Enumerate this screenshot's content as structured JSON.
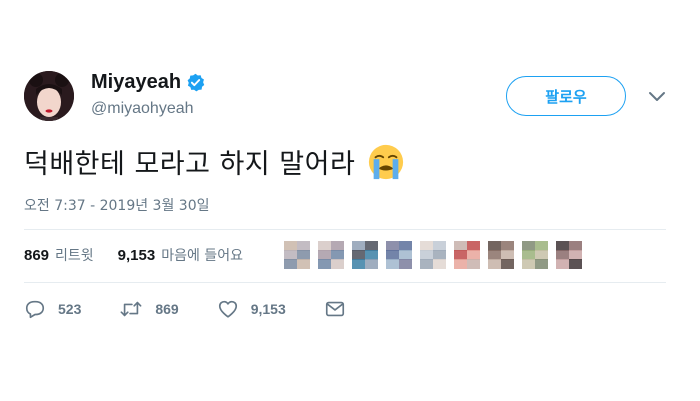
{
  "user": {
    "display_name": "Miyayeah",
    "handle": "@miyaohyeah",
    "verified": true
  },
  "follow_button": {
    "label": "팔로우"
  },
  "tweet": {
    "text": "덕배한테 모라고 하지 말어라",
    "emoji": "loudly-crying-face",
    "timestamp": "오전 7:37 - 2019년 3월 30일"
  },
  "stats": {
    "retweets_count": "869",
    "retweets_label": "리트윗",
    "likes_count": "9,153",
    "likes_label": "마음에 들어요"
  },
  "liker_avatars": [
    {
      "colors": [
        "#b8b0b8",
        "#7a8aa0",
        "#c9b6a8"
      ]
    },
    {
      "colors": [
        "#a89aa6",
        "#6e86a4",
        "#d5c7c3"
      ]
    },
    {
      "colors": [
        "#4a4f5a",
        "#3a7fa5",
        "#8e9fb4"
      ]
    },
    {
      "colors": [
        "#5a6e9a",
        "#a0b6cc",
        "#7a7c9c"
      ]
    },
    {
      "colors": [
        "#c0c8d2",
        "#9aa6b4",
        "#e0d6d0"
      ]
    },
    {
      "colors": [
        "#c04a4a",
        "#e8a49a",
        "#c7b0aa"
      ]
    },
    {
      "colors": [
        "#8a7066",
        "#c6b2a6",
        "#5a4a44"
      ]
    },
    {
      "colors": [
        "#9ab27a",
        "#c6c0a6",
        "#7c8870"
      ]
    },
    {
      "colors": [
        "#8a6a6a",
        "#c9a4a4",
        "#3e3436"
      ]
    }
  ],
  "actions": {
    "replies": "523",
    "retweets": "869",
    "likes": "9,153"
  },
  "colors": {
    "accent": "#1da1f2",
    "text": "#14171a",
    "secondary": "#657786",
    "divider": "#e6ecf0"
  }
}
